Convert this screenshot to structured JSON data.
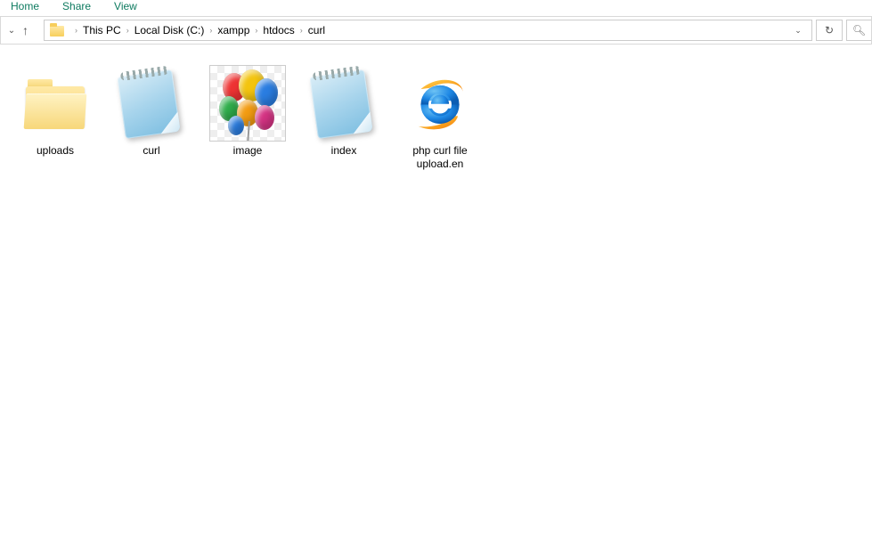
{
  "tabs": {
    "home": "Home",
    "share": "Share",
    "view": "View"
  },
  "breadcrumb": {
    "items": [
      "This PC",
      "Local Disk (C:)",
      "xampp",
      "htdocs",
      "curl"
    ]
  },
  "items": [
    {
      "name": "uploads",
      "icon": "folder"
    },
    {
      "name": "curl",
      "icon": "notepad"
    },
    {
      "name": "image",
      "icon": "balloons"
    },
    {
      "name": "index",
      "icon": "notepad"
    },
    {
      "name": "php curl file upload.en",
      "icon": "ie"
    }
  ]
}
